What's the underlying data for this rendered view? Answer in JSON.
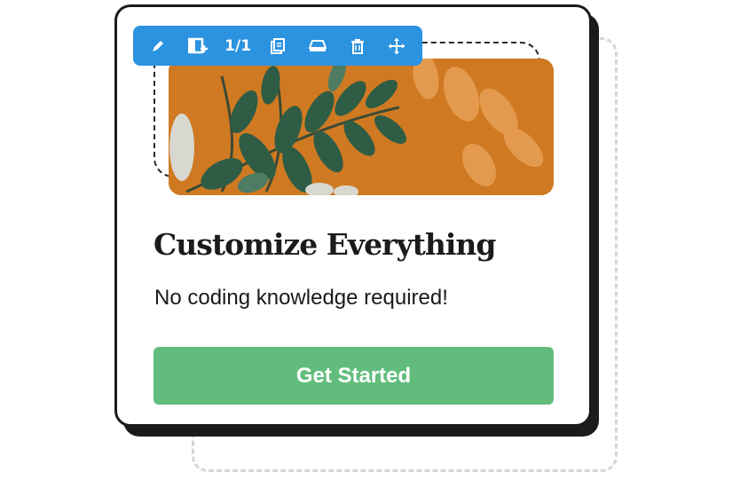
{
  "toolbar": {
    "count_label": "1/1",
    "icons": [
      "edit-icon",
      "add-block-icon",
      "copy-icon",
      "background-icon",
      "delete-icon",
      "move-icon"
    ],
    "color": "#2b93e0"
  },
  "card": {
    "title": "Customize Everything",
    "subtitle": "No coding knowledge required!",
    "cta_label": "Get Started",
    "cta_color": "#62bd7c"
  },
  "hero_image": {
    "subject": "green leaves on orange background",
    "background_color": "#d07a1f"
  }
}
